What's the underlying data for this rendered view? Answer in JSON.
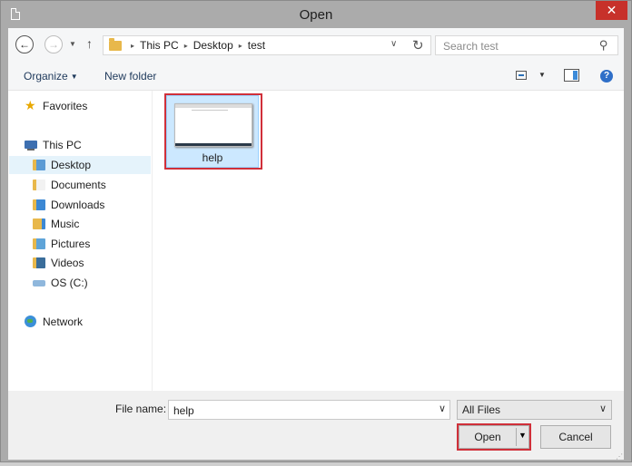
{
  "window": {
    "title": "Open",
    "close_glyph": "✕"
  },
  "nav": {
    "back_glyph": "←",
    "forward_glyph": "→",
    "recent_glyph": "▼",
    "up_glyph": "↑"
  },
  "address": {
    "crumbs": [
      "This PC",
      "Desktop",
      "test"
    ],
    "separator_glyph": "▸",
    "drop_glyph": "∨",
    "refresh_glyph": "↻"
  },
  "search": {
    "placeholder": "Search test",
    "icon": "search-icon",
    "glyph": "⚲"
  },
  "toolbar": {
    "organize_label": "Organize",
    "organize_arrow": "▼",
    "new_folder_label": "New folder",
    "views_drop_glyph": "▼",
    "help_glyph": "?"
  },
  "sidebar": {
    "favorites": "Favorites",
    "this_pc": "This PC",
    "items": [
      {
        "label": "Desktop",
        "icon": "desktop-folder-icon"
      },
      {
        "label": "Documents",
        "icon": "documents-folder-icon"
      },
      {
        "label": "Downloads",
        "icon": "downloads-folder-icon"
      },
      {
        "label": "Music",
        "icon": "music-folder-icon"
      },
      {
        "label": "Pictures",
        "icon": "pictures-folder-icon"
      },
      {
        "label": "Videos",
        "icon": "videos-folder-icon"
      },
      {
        "label": "OS (C:)",
        "icon": "drive-icon"
      }
    ],
    "network": "Network",
    "selected": "Desktop"
  },
  "files": [
    {
      "name": "help",
      "selected": true
    }
  ],
  "footer": {
    "file_name_label": "File name:",
    "file_name_value": "help",
    "combo_drop_glyph": "∨",
    "filter_value": "All Files",
    "filter_drop_glyph": "∨",
    "open_label": "Open",
    "open_arrow": "▼",
    "cancel_label": "Cancel",
    "grip_glyph": "⋰"
  },
  "colors": {
    "highlight_box": "#d0303a",
    "selection": "#cce8ff",
    "close_button": "#c7312a"
  }
}
